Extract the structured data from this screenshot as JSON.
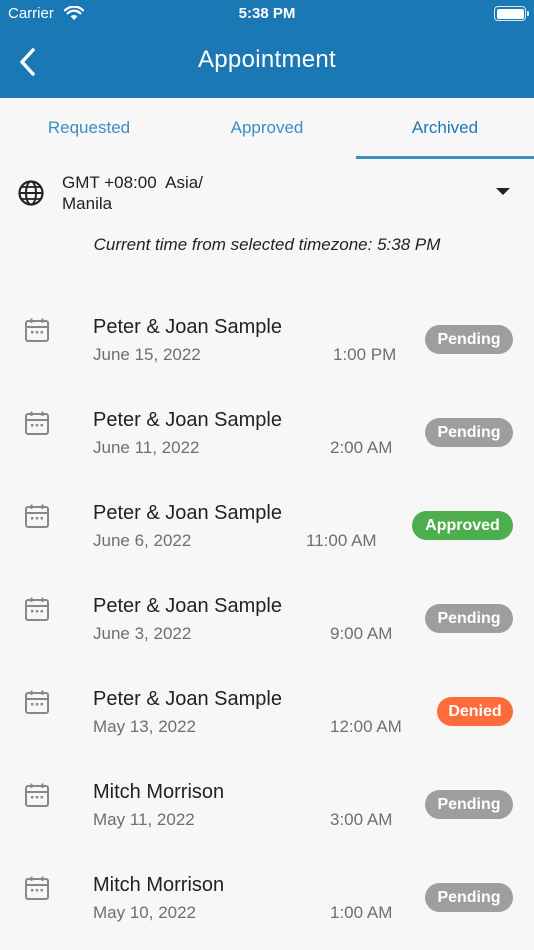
{
  "status_bar": {
    "carrier": "Carrier",
    "time": "5:38 PM"
  },
  "header": {
    "title": "Appointment"
  },
  "tabs": [
    {
      "label": "Requested"
    },
    {
      "label": "Approved"
    },
    {
      "label": "Archived",
      "active": true
    }
  ],
  "timezone": {
    "line1": "GMT +08:00  Asia/",
    "line2": "Manila",
    "current_time": "Current time from selected timezone: 5:38 PM"
  },
  "colors": {
    "header": "#1a79b5",
    "tab_text": "#3c8fc1",
    "pending": "#9e9e9e",
    "approved": "#4cae4c",
    "denied": "#ff6c3b"
  },
  "appointments": [
    {
      "name": "Peter & Joan Sample",
      "date": "June 15, 2022",
      "time": "1:00 PM",
      "status": "Pending",
      "status_type": "pending"
    },
    {
      "name": "Peter & Joan Sample",
      "date": "June 11, 2022",
      "time": "2:00 AM",
      "status": "Pending",
      "status_type": "pending"
    },
    {
      "name": "Peter & Joan Sample",
      "date": "June 6, 2022",
      "time": "11:00 AM",
      "status": "Approved",
      "status_type": "approved"
    },
    {
      "name": "Peter & Joan Sample",
      "date": "June 3, 2022",
      "time": "9:00 AM",
      "status": "Pending",
      "status_type": "pending"
    },
    {
      "name": "Peter & Joan Sample",
      "date": "May 13, 2022",
      "time": "12:00 AM",
      "status": "Denied",
      "status_type": "denied"
    },
    {
      "name": "Mitch Morrison",
      "date": "May 11, 2022",
      "time": "3:00 AM",
      "status": "Pending",
      "status_type": "pending"
    },
    {
      "name": "Mitch Morrison",
      "date": "May 10, 2022",
      "time": "1:00 AM",
      "status": "Pending",
      "status_type": "pending"
    }
  ]
}
